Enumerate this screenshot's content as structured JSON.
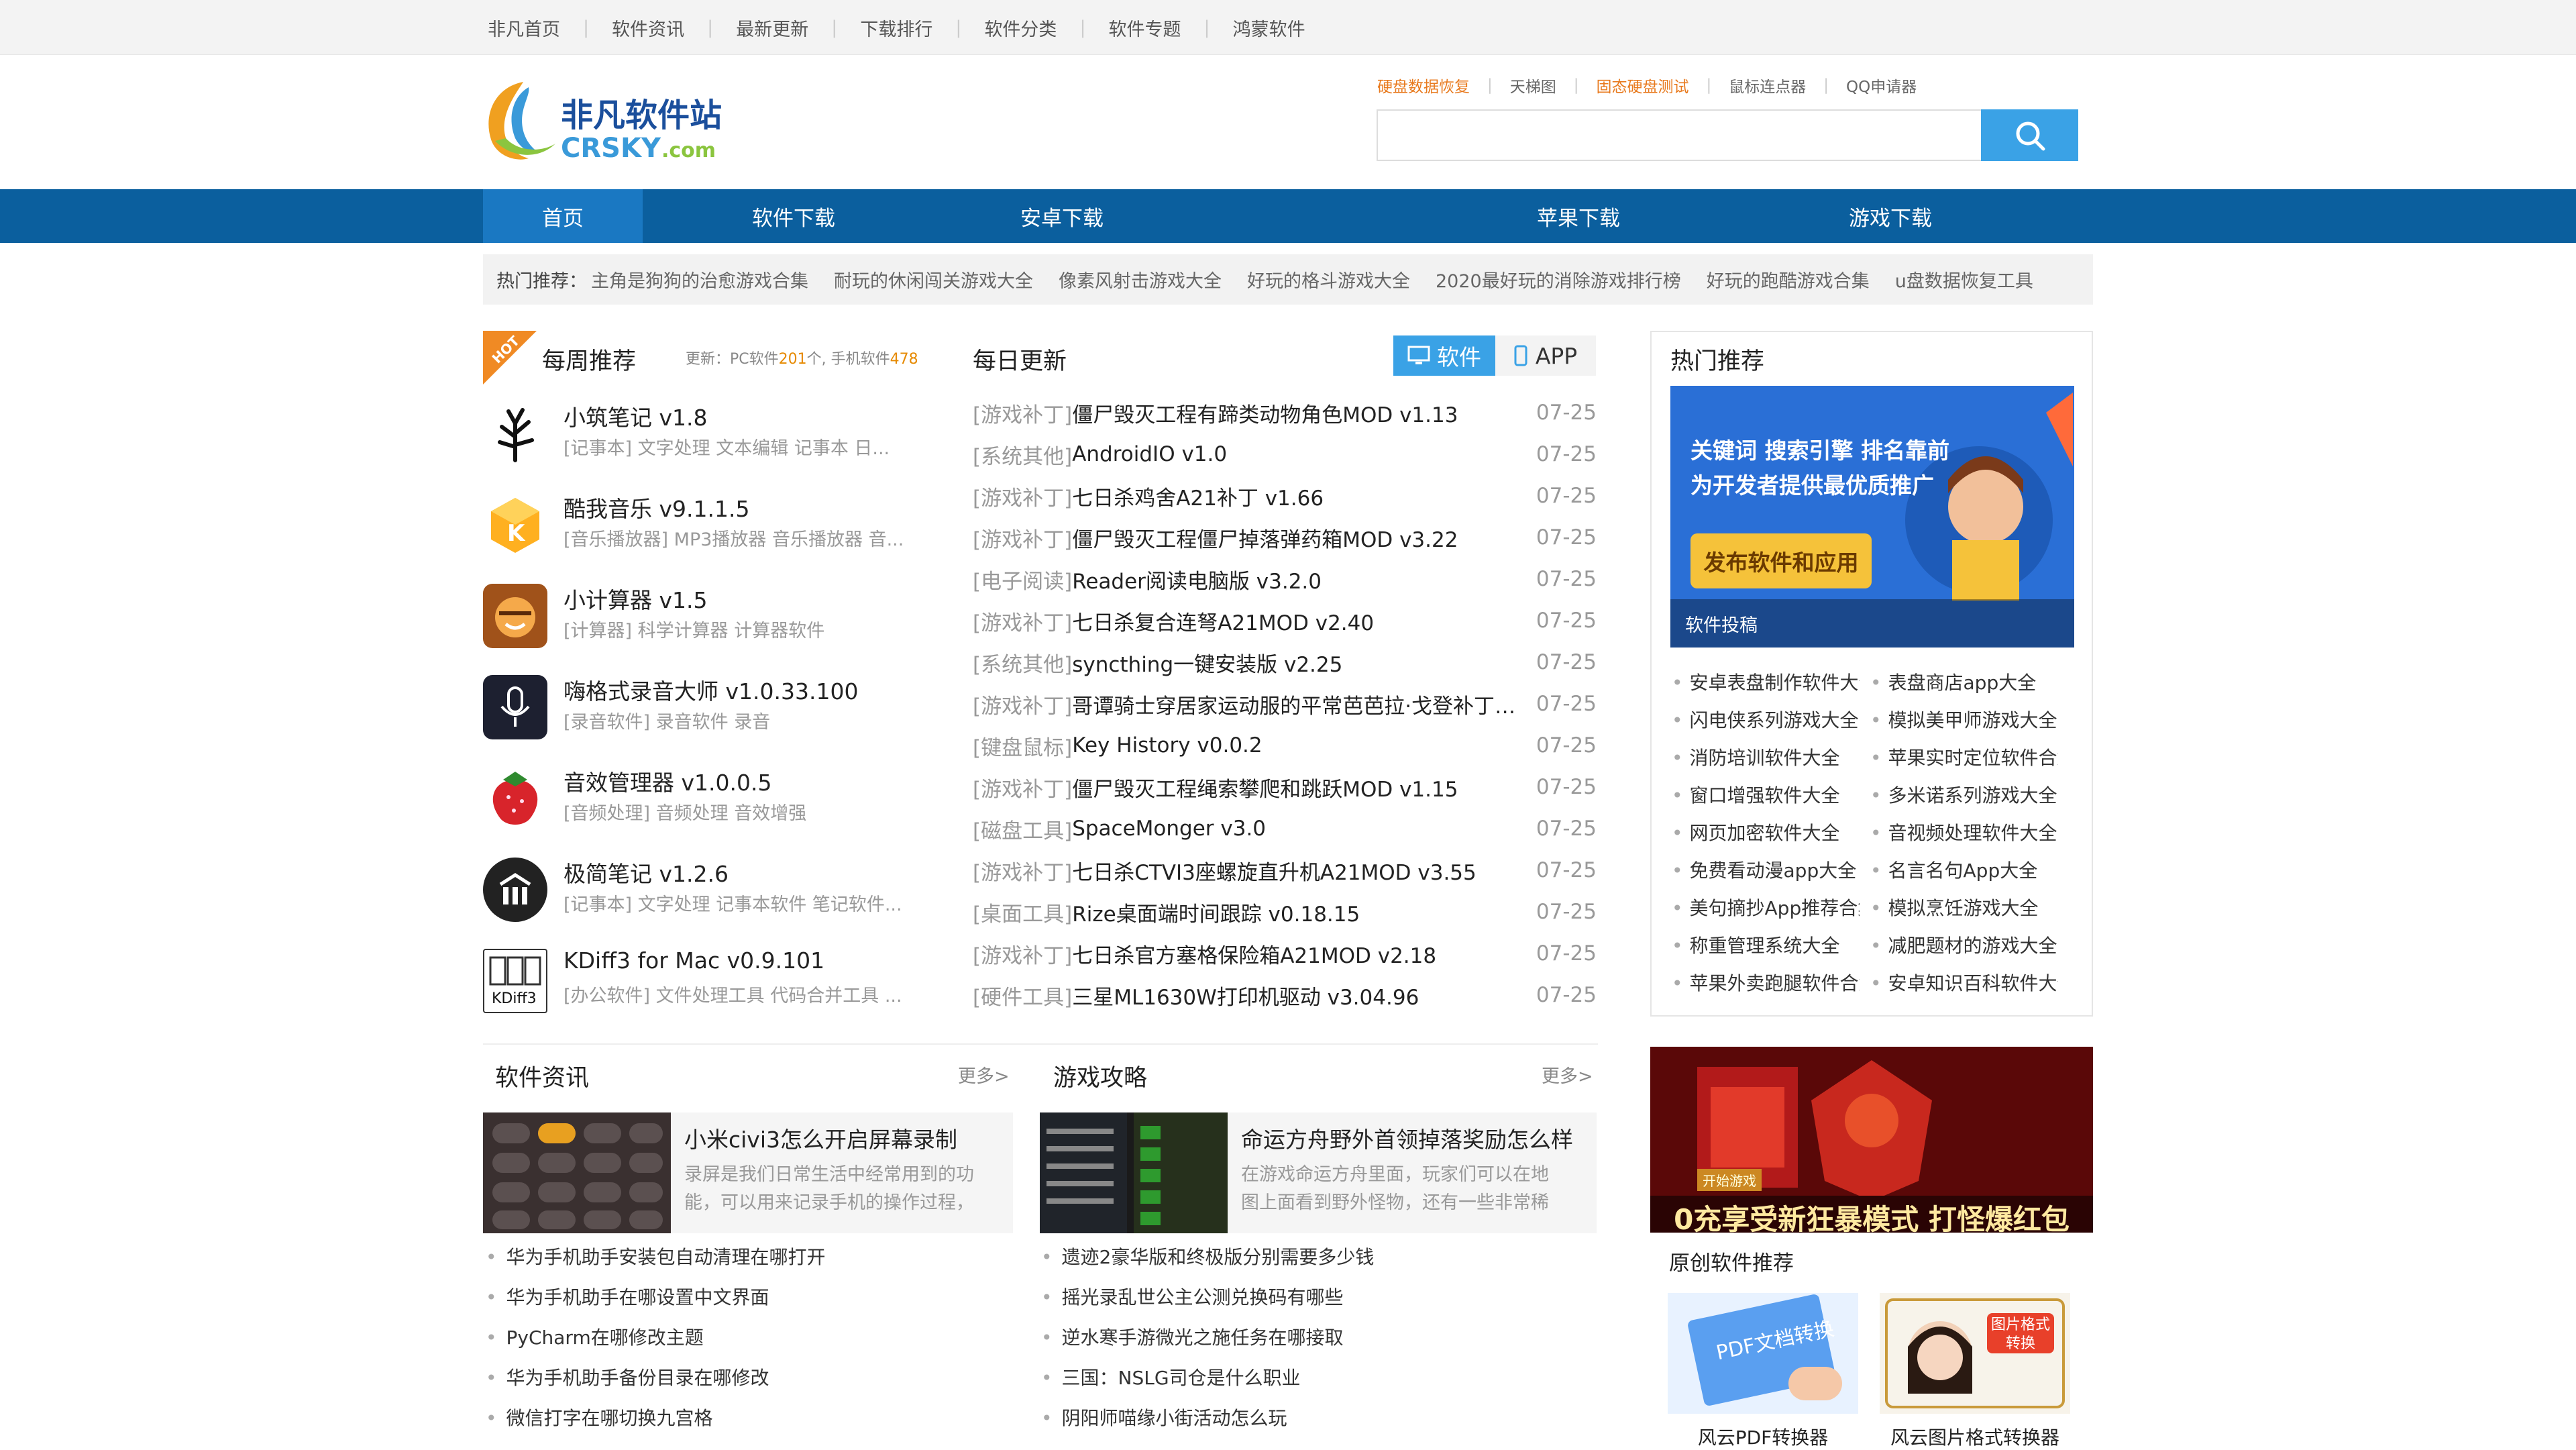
{
  "topnav": [
    "非凡首页",
    "软件资讯",
    "最新更新",
    "下载排行",
    "软件分类",
    "软件专题",
    "鸿蒙软件"
  ],
  "logo": {
    "cn": "非凡软件站",
    "en": "CRSKY.com"
  },
  "hotwords": [
    "硬盘数据恢复",
    "天梯图",
    "固态硬盘测试",
    "鼠标连点器",
    "QQ申请器"
  ],
  "search": {
    "placeholder": ""
  },
  "mainnav": [
    "首页",
    "软件下载",
    "安卓下载",
    "苹果下载",
    "游戏下载"
  ],
  "hot_recommend": {
    "label": "热门推荐：",
    "items": [
      "主角是狗狗的治愈游戏合集",
      "耐玩的休闲闯关游戏大全",
      "像素风射击游戏大全",
      "好玩的格斗游戏大全",
      "2020最好玩的消除游戏排行榜",
      "好玩的跑酷游戏合集",
      "u盘数据恢复工具"
    ]
  },
  "weekly": {
    "title": "每周推荐",
    "hot_tag": "HOT",
    "update_prefix": "更新：PC软件",
    "pc_count": "201",
    "mid": "个, 手机软件",
    "mobile_count": "478",
    "items": [
      {
        "name": "小筑笔记 v1.8",
        "tags": "[记事本]  文字处理    文本编辑    记事本    日..."
      },
      {
        "name": "酷我音乐 v9.1.1.5",
        "tags": "[音乐播放器]  MP3播放器    音乐播放器    音..."
      },
      {
        "name": "小计算器 v1.5",
        "tags": "[计算器]  科学计算器    计算器软件"
      },
      {
        "name": "嗨格式录音大师 v1.0.33.100",
        "tags": "[录音软件]  录音软件    录音"
      },
      {
        "name": "音效管理器 v1.0.0.5",
        "tags": "[音频处理]  音频处理    音效增强"
      },
      {
        "name": "极简笔记 v1.2.6",
        "tags": "[记事本]  文字处理    记事本软件    笔记软件..."
      },
      {
        "name": "KDiff3 for Mac v0.9.101",
        "tags": "[办公软件]  文件处理工具    代码合并工具    ..."
      }
    ]
  },
  "daily": {
    "title": "每日更新",
    "tab_soft": "软件",
    "tab_app": "APP",
    "rows": [
      {
        "cat": "[游戏补丁]",
        "name": "僵尸毁灭工程有蹄类动物角色MOD v1.13",
        "date": "07-25"
      },
      {
        "cat": "[系统其他]",
        "name": "AndroidIO v1.0",
        "date": "07-25"
      },
      {
        "cat": "[游戏补丁]",
        "name": "七日杀鸡舍A21补丁 v1.66",
        "date": "07-25"
      },
      {
        "cat": "[游戏补丁]",
        "name": "僵尸毁灭工程僵尸掉落弹药箱MOD v3.22",
        "date": "07-25"
      },
      {
        "cat": "[电子阅读]",
        "name": "Reader阅读电脑版 v3.2.0",
        "date": "07-25"
      },
      {
        "cat": "[游戏补丁]",
        "name": "七日杀复合连弩A21MOD v2.40",
        "date": "07-25"
      },
      {
        "cat": "[系统其他]",
        "name": "syncthing一键安装版 v2.25",
        "date": "07-25"
      },
      {
        "cat": "[游戏补丁]",
        "name": "哥谭骑士穿居家运动服的平常芭芭拉·戈登补丁 v...",
        "date": "07-25"
      },
      {
        "cat": "[键盘鼠标]",
        "name": "Key History v0.0.2",
        "date": "07-25"
      },
      {
        "cat": "[游戏补丁]",
        "name": "僵尸毁灭工程绳索攀爬和跳跃MOD v1.15",
        "date": "07-25"
      },
      {
        "cat": "[磁盘工具]",
        "name": "SpaceMonger v3.0",
        "date": "07-25"
      },
      {
        "cat": "[游戏补丁]",
        "name": "七日杀CTVI3座螺旋直升机A21MOD v3.55",
        "date": "07-25"
      },
      {
        "cat": "[桌面工具]",
        "name": "Rize桌面端时间跟踪 v0.18.15",
        "date": "07-25"
      },
      {
        "cat": "[游戏补丁]",
        "name": "七日杀官方塞格保险箱A21MOD v2.18",
        "date": "07-25"
      },
      {
        "cat": "[硬件工具]",
        "name": "三星ML1630W打印机驱动 v3.04.96",
        "date": "07-25"
      }
    ]
  },
  "right": {
    "title": "热门推荐",
    "banner_line1": "关键词  搜索引擎  排名靠前",
    "banner_line2": "为开发者提供最优质推广",
    "banner_button": "发布软件和应用",
    "banner_caption": "软件投稿",
    "col1": [
      "安卓表盘制作软件大全",
      "闪电侠系列游戏大全",
      "消防培训软件大全",
      "窗口增强软件大全",
      "网页加密软件大全",
      "免费看动漫app大全",
      "美句摘抄App推荐合集",
      "称重管理系统大全",
      "苹果外卖跑腿软件合集"
    ],
    "col2": [
      "表盘商店app大全",
      "模拟美甲师游戏大全",
      "苹果实时定位软件合集",
      "多米诺系列游戏大全",
      "音视频处理软件大全",
      "名言名句App大全",
      "模拟烹饪游戏大全",
      "减肥题材的游戏大全",
      "安卓知识百科软件大全"
    ]
  },
  "news": {
    "title": "软件资讯",
    "more": "更多>",
    "card_title": "小米civi3怎么开启屏幕录制",
    "card_desc": "录屏是我们日常生活中经常用到的功能，可以用来记录手机的操作过程，",
    "items": [
      "华为手机助手安装包自动清理在哪打开",
      "华为手机助手在哪设置中文界面",
      "PyCharm在哪修改主题",
      "华为手机助手备份目录在哪修改",
      "微信打字在哪切换九宫格"
    ]
  },
  "guides": {
    "title": "游戏攻略",
    "more": "更多>",
    "card_title": "命运方舟野外首领掉落奖励怎么样",
    "card_desc": "在游戏命运方舟里面，玩家们可以在地图上面看到野外怪物，还有一些非常稀",
    "items": [
      "遗迹2豪华版和终极版分别需要多少钱",
      "摇光录乱世公主公测兑换码有哪些",
      "逆水寒手游微光之施任务在哪接取",
      "三国：NSLG司仓是什么职业",
      "阴阳师喵缘小街活动怎么玩"
    ]
  },
  "game_ad": {
    "start": "开始游戏",
    "slogan": "0充享受新狂暴模式 打怪爆红包"
  },
  "original": {
    "title": "原创软件推荐",
    "items": [
      {
        "name": "风云PDF转换器",
        "img_text": "PDF文档转换"
      },
      {
        "name": "风云图片格式转换器",
        "img_text": "图片格式转换"
      }
    ]
  },
  "colors": {
    "nav": "#0b5f9e",
    "nav_active": "#1a78c2",
    "accent": "#3aa2e6",
    "orange": "#e87a1e"
  }
}
